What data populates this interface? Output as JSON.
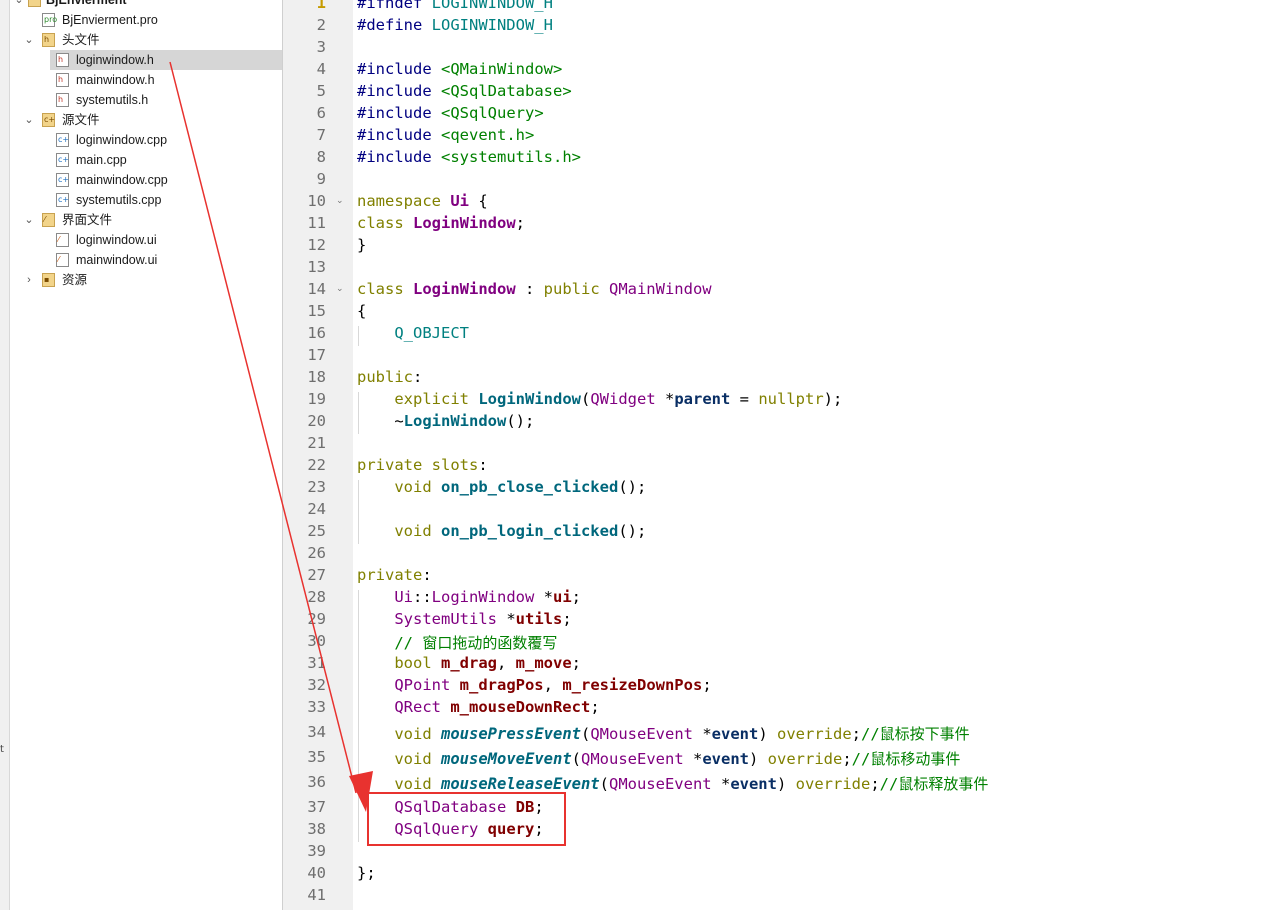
{
  "left_strip": {
    "text": "t"
  },
  "tree": {
    "project": "BjEnvierment",
    "items": [
      {
        "label": "BjEnvierment.pro",
        "icon": "pro-file-icon",
        "level": 1
      },
      {
        "label": "头文件",
        "icon": "folder-headers-icon",
        "level": 1,
        "expanded": true
      },
      {
        "label": "loginwindow.h",
        "icon": "header-file-icon",
        "level": 2,
        "selected": true
      },
      {
        "label": "mainwindow.h",
        "icon": "header-file-icon",
        "level": 2
      },
      {
        "label": "systemutils.h",
        "icon": "header-file-icon",
        "level": 2
      },
      {
        "label": "源文件",
        "icon": "folder-sources-icon",
        "level": 1,
        "expanded": true
      },
      {
        "label": "loginwindow.cpp",
        "icon": "cpp-file-icon",
        "level": 2
      },
      {
        "label": "main.cpp",
        "icon": "cpp-file-icon",
        "level": 2
      },
      {
        "label": "mainwindow.cpp",
        "icon": "cpp-file-icon",
        "level": 2
      },
      {
        "label": "systemutils.cpp",
        "icon": "cpp-file-icon",
        "level": 2
      },
      {
        "label": "界面文件",
        "icon": "folder-forms-icon",
        "level": 1,
        "expanded": true
      },
      {
        "label": "loginwindow.ui",
        "icon": "ui-file-icon",
        "level": 2
      },
      {
        "label": "mainwindow.ui",
        "icon": "ui-file-icon",
        "level": 2
      },
      {
        "label": "资源",
        "icon": "folder-resources-icon",
        "level": 1,
        "expanded": false
      }
    ]
  },
  "editor": {
    "current_line": 1,
    "lines": [
      [
        [
          "pp",
          "#ifndef "
        ],
        [
          "",
          ""
        ],
        [
          "mac",
          "LOGINWINDOW_H"
        ]
      ],
      [
        [
          "pp",
          "#define "
        ],
        [
          "mac",
          "LOGINWINDOW_H"
        ]
      ],
      [],
      [
        [
          "pp",
          "#include "
        ],
        [
          "inc",
          "<QMainWindow>"
        ]
      ],
      [
        [
          "pp",
          "#include "
        ],
        [
          "inc",
          "<QSqlDatabase>"
        ]
      ],
      [
        [
          "pp",
          "#include "
        ],
        [
          "inc",
          "<QSqlQuery>"
        ]
      ],
      [
        [
          "pp",
          "#include "
        ],
        [
          "inc",
          "<qevent.h>"
        ]
      ],
      [
        [
          "pp",
          "#include "
        ],
        [
          "inc",
          "<systemutils.h>"
        ]
      ],
      [],
      [
        [
          "kw",
          "namespace "
        ],
        [
          "cls",
          "Ui"
        ],
        [
          "",
          " {"
        ]
      ],
      [
        [
          "kw",
          "class "
        ],
        [
          "cls",
          "LoginWindow"
        ],
        [
          "",
          ";"
        ]
      ],
      [
        [
          "",
          "}"
        ]
      ],
      [],
      [
        [
          "kw",
          "class "
        ],
        [
          "cls",
          "LoginWindow"
        ],
        [
          "",
          " : "
        ],
        [
          "kw",
          "public "
        ],
        [
          "ty",
          "QMainWindow"
        ]
      ],
      [
        [
          "",
          "{"
        ]
      ],
      [
        [
          "",
          "    "
        ],
        [
          "mac",
          "Q_OBJECT"
        ]
      ],
      [],
      [
        [
          "kw",
          "public"
        ],
        [
          "",
          ":"
        ]
      ],
      [
        [
          "",
          "    "
        ],
        [
          "kw",
          "explicit "
        ],
        [
          "fn",
          "LoginWindow"
        ],
        [
          "",
          "("
        ],
        [
          "ty",
          "QWidget"
        ],
        [
          "",
          " *"
        ],
        [
          "par",
          "parent"
        ],
        [
          "",
          " = "
        ],
        [
          "kw",
          "nullptr"
        ],
        [
          "",
          ");"
        ]
      ],
      [
        [
          "",
          "    ~"
        ],
        [
          "fn",
          "LoginWindow"
        ],
        [
          "",
          "();"
        ]
      ],
      [],
      [
        [
          "kw",
          "private slots"
        ],
        [
          "",
          ":"
        ]
      ],
      [
        [
          "",
          "    "
        ],
        [
          "kw",
          "void "
        ],
        [
          "fn",
          "on_pb_close_clicked"
        ],
        [
          "",
          "();"
        ]
      ],
      [],
      [
        [
          "",
          "    "
        ],
        [
          "kw",
          "void "
        ],
        [
          "fn",
          "on_pb_login_clicked"
        ],
        [
          "",
          "();"
        ]
      ],
      [],
      [
        [
          "kw",
          "private"
        ],
        [
          "",
          ":"
        ]
      ],
      [
        [
          "",
          "    "
        ],
        [
          "ty",
          "Ui"
        ],
        [
          "",
          "::"
        ],
        [
          "ty",
          "LoginWindow"
        ],
        [
          "",
          " *"
        ],
        [
          "mem",
          "ui"
        ],
        [
          "",
          ";"
        ]
      ],
      [
        [
          "",
          "    "
        ],
        [
          "ty",
          "SystemUtils"
        ],
        [
          "",
          " *"
        ],
        [
          "mem",
          "utils"
        ],
        [
          "",
          ";"
        ]
      ],
      [
        [
          "",
          "    "
        ],
        [
          "cmt",
          "// "
        ],
        [
          "cmt-cn",
          "窗口拖动的函数覆写"
        ]
      ],
      [
        [
          "",
          "    "
        ],
        [
          "kw",
          "bool "
        ],
        [
          "mem",
          "m_drag"
        ],
        [
          "",
          ", "
        ],
        [
          "mem",
          "m_move"
        ],
        [
          "",
          ";"
        ]
      ],
      [
        [
          "",
          "    "
        ],
        [
          "ty",
          "QPoint "
        ],
        [
          "mem",
          "m_dragPos"
        ],
        [
          "",
          ", "
        ],
        [
          "mem",
          "m_resizeDownPos"
        ],
        [
          "",
          ";"
        ]
      ],
      [
        [
          "",
          "    "
        ],
        [
          "ty",
          "QRect "
        ],
        [
          "mem",
          "m_mouseDownRect"
        ],
        [
          "",
          ";"
        ]
      ],
      [
        [
          "",
          "    "
        ],
        [
          "kw",
          "void "
        ],
        [
          "vfn",
          "mousePressEvent"
        ],
        [
          "",
          "("
        ],
        [
          "ty",
          "QMouseEvent"
        ],
        [
          "",
          " *"
        ],
        [
          "par",
          "event"
        ],
        [
          "",
          ") "
        ],
        [
          "kw",
          "override"
        ],
        [
          "",
          ";"
        ],
        [
          "cmt",
          "//"
        ],
        [
          "cmt-cn",
          "鼠标按下事件"
        ]
      ],
      [
        [
          "",
          "    "
        ],
        [
          "kw",
          "void "
        ],
        [
          "vfn",
          "mouseMoveEvent"
        ],
        [
          "",
          "("
        ],
        [
          "ty",
          "QMouseEvent"
        ],
        [
          "",
          " *"
        ],
        [
          "par",
          "event"
        ],
        [
          "",
          ") "
        ],
        [
          "kw",
          "override"
        ],
        [
          "",
          ";"
        ],
        [
          "cmt",
          "//"
        ],
        [
          "cmt-cn",
          "鼠标移动事件"
        ]
      ],
      [
        [
          "",
          "    "
        ],
        [
          "kw",
          "void "
        ],
        [
          "vfn",
          "mouseReleaseEvent"
        ],
        [
          "",
          "("
        ],
        [
          "ty",
          "QMouseEvent"
        ],
        [
          "",
          " *"
        ],
        [
          "par",
          "event"
        ],
        [
          "",
          ") "
        ],
        [
          "kw",
          "override"
        ],
        [
          "",
          ";"
        ],
        [
          "cmt",
          "//"
        ],
        [
          "cmt-cn",
          "鼠标释放事件"
        ]
      ],
      [
        [
          "",
          "    "
        ],
        [
          "ty",
          "QSqlDatabase "
        ],
        [
          "mem",
          "DB"
        ],
        [
          "",
          ";"
        ]
      ],
      [
        [
          "",
          "    "
        ],
        [
          "ty",
          "QSqlQuery "
        ],
        [
          "mem",
          "query"
        ],
        [
          "",
          ";"
        ]
      ],
      [],
      [
        [
          "",
          "};"
        ]
      ],
      []
    ]
  },
  "annotation": {
    "color": "#e8322f"
  },
  "colors": {
    "selection": "#d6d6d6",
    "gutter": "#f0f0f0",
    "highlight": "#e8322f"
  }
}
